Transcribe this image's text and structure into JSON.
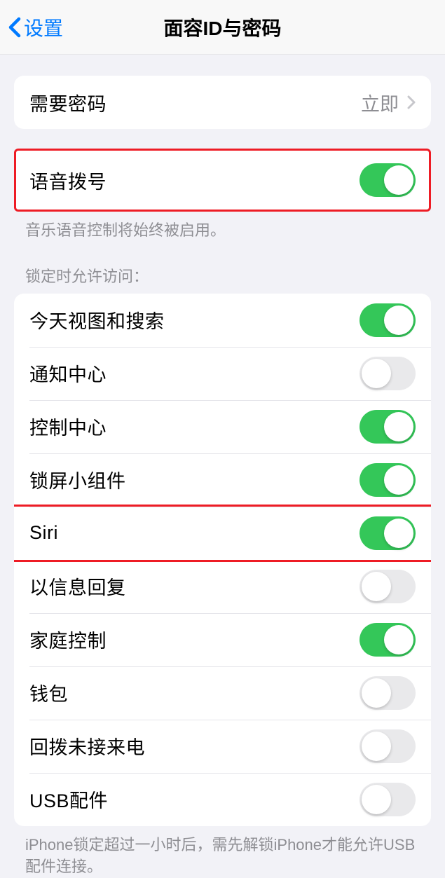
{
  "navbar": {
    "back_label": "设置",
    "title": "面容ID与密码"
  },
  "passcode_group": {
    "require_label": "需要密码",
    "require_value": "立即"
  },
  "voice_dial": {
    "label": "语音拨号",
    "on": true,
    "footer": "音乐语音控制将始终被启用。"
  },
  "locked_header": "锁定时允许访问：",
  "locked_items": [
    {
      "label": "今天视图和搜索",
      "on": true
    },
    {
      "label": "通知中心",
      "on": false
    },
    {
      "label": "控制中心",
      "on": true
    },
    {
      "label": "锁屏小组件",
      "on": true
    },
    {
      "label": "Siri",
      "on": true
    },
    {
      "label": "以信息回复",
      "on": false
    },
    {
      "label": "家庭控制",
      "on": true
    },
    {
      "label": "钱包",
      "on": false
    },
    {
      "label": "回拨未接来电",
      "on": false
    },
    {
      "label": "USB配件",
      "on": false
    }
  ],
  "locked_footer": "iPhone锁定超过一小时后，需先解锁iPhone才能允许USB配件连接。"
}
